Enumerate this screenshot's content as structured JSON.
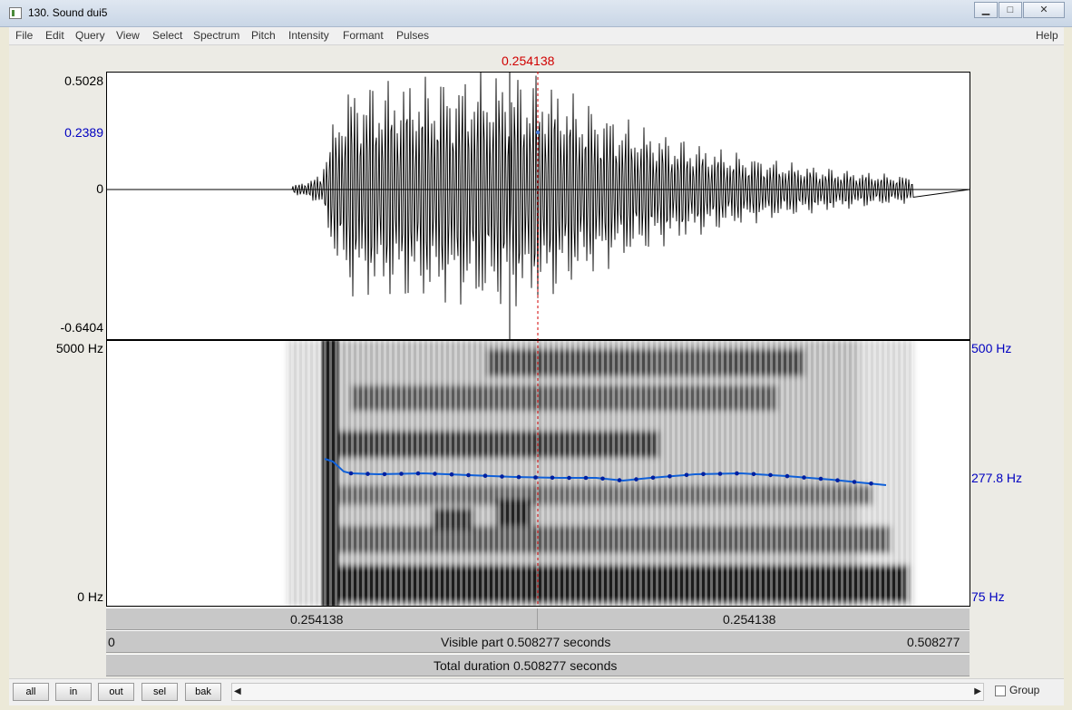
{
  "window": {
    "title": "130. Sound dui5",
    "buttons": {
      "minimize": "▁",
      "maximize": "□",
      "close": "✕"
    }
  },
  "menu": {
    "items": [
      "File",
      "Edit",
      "Query",
      "View",
      "Select",
      "Spectrum",
      "Pitch",
      "Intensity",
      "Formant",
      "Pulses"
    ],
    "help": "Help"
  },
  "cursor": {
    "time": "0.254138"
  },
  "waveform": {
    "max": "0.5028",
    "cursor_value": "0.2389",
    "zero": "0",
    "min": "-0.6404"
  },
  "spectrogram": {
    "top_freq": "5000 Hz",
    "bottom_freq": "0 Hz",
    "pitch_top": "500 Hz",
    "pitch_value": "277.8 Hz",
    "pitch_bottom": "75 Hz"
  },
  "time_bands": {
    "left_half": "0.254138",
    "right_half": "0.254138",
    "visible_start": "0",
    "visible_label": "Visible part 0.508277 seconds",
    "visible_end": "0.508277",
    "total_label": "Total duration 0.508277 seconds"
  },
  "bottom": {
    "buttons": {
      "all": "all",
      "in": "in",
      "out": "out",
      "sel": "sel",
      "bak": "bak"
    },
    "left_arrow": "◀",
    "right_arrow": "▶",
    "group_label": "Group"
  },
  "colors": {
    "cursor": "#d00000",
    "pitch": "#1060d8",
    "axis_value": "#0000c0"
  }
}
